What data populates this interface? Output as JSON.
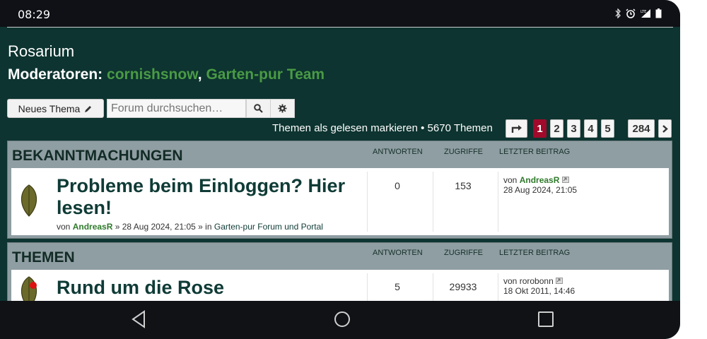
{
  "status_bar": {
    "time": "08:29",
    "icons": [
      "bluetooth-icon",
      "alarm-icon",
      "signal-lte-icon",
      "battery-icon"
    ]
  },
  "forum": {
    "title": "Rosarium",
    "moderators_label": "Moderatoren: ",
    "moderator_1": "cornishsnow",
    "separator": ",",
    "moderator_2": "Garten-pur Team"
  },
  "actions": {
    "new_topic_label": "Neues Thema",
    "search_placeholder": "Forum durchsuchen…",
    "mark_read": "Themen als gelesen markieren",
    "bullet": "•",
    "topic_count": "5670 Themen"
  },
  "pagination": {
    "pages": [
      "1",
      "2",
      "3",
      "4",
      "5",
      "284"
    ],
    "current": "1"
  },
  "announcements": {
    "title": "BEKANNTMACHUNGEN",
    "col_replies": "ANTWORTEN",
    "col_views": "ZUGRIFFE",
    "col_last": "LETZTER BEITRAG",
    "topic": {
      "title_line1": "Probleme beim Einloggen? Hier",
      "title_line2": "lesen!",
      "by": "von",
      "author": "AndreasR",
      "date": "» 28 Aug 2024, 21:05 » in",
      "forum_link": "Garten-pur Forum und Portal",
      "replies": "0",
      "views": "153",
      "last_by": "von",
      "last_author": "AndreasR",
      "last_date": "28 Aug 2024, 21:05"
    }
  },
  "topics": {
    "title": "THEMEN",
    "col_replies": "ANTWORTEN",
    "col_views": "ZUGRIFFE",
    "col_last": "LETZTER BEITRAG",
    "topic": {
      "title": "Rund um die Rose",
      "replies": "5",
      "views": "29933",
      "last_by": "von",
      "last_author": "rorobonn",
      "last_date": "18 Okt 2011, 14:46"
    }
  },
  "colors": {
    "background": "#0d3430",
    "accent_green": "#4a9a45",
    "active_page": "#a10a2a",
    "section_header": "#8f9ea2"
  }
}
